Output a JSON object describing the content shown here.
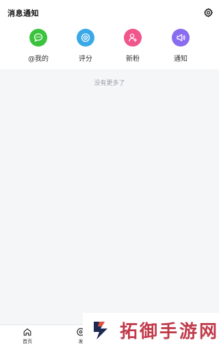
{
  "header": {
    "title": "消息通知",
    "settings_icon": "gear-icon"
  },
  "categories": [
    {
      "label": "@我的",
      "icon": "chat-bubble-icon",
      "color": "#3cc33d"
    },
    {
      "label": "评分",
      "icon": "target-icon",
      "color": "#3aa9e8"
    },
    {
      "label": "新粉",
      "icon": "new-follower-icon",
      "color": "#f0558b"
    },
    {
      "label": "通知",
      "icon": "megaphone-icon",
      "color": "#8a6cf0"
    }
  ],
  "empty_state": "没有更多了",
  "tabbar": {
    "tabs": [
      {
        "label": "首页",
        "icon": "home-icon"
      },
      {
        "label": "发",
        "icon": "discover-icon"
      }
    ]
  },
  "watermark": {
    "text": "拓御手游网",
    "logo": "brand-logo"
  }
}
